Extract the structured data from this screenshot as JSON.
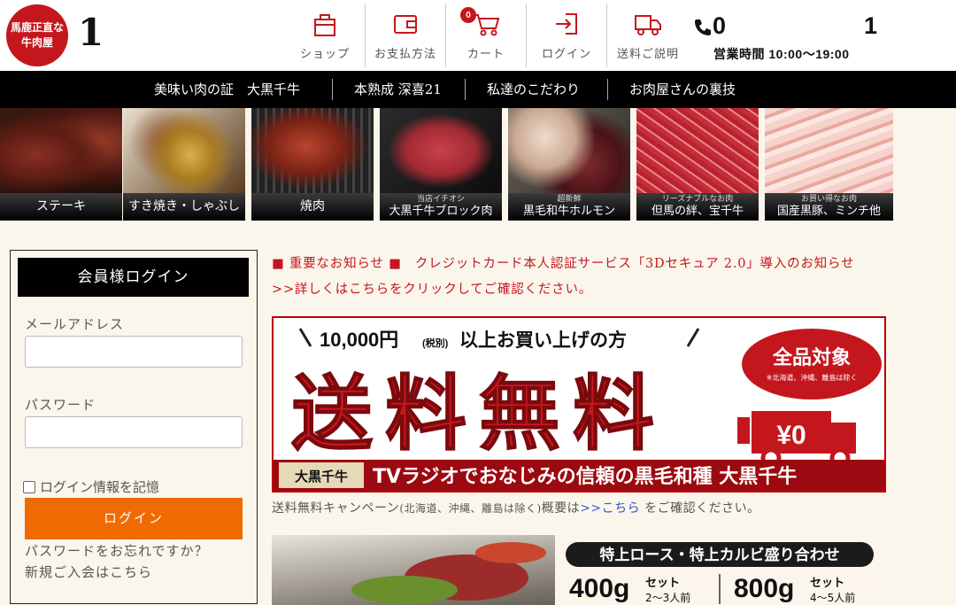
{
  "header": {
    "logo_lines": [
      "馬鹿正直な",
      "牛肉屋"
    ],
    "brand_fragment": "1",
    "nav": [
      {
        "label": "ショップ",
        "icon": "shop-bag-icon"
      },
      {
        "label": "お支払方法",
        "icon": "wallet-icon"
      },
      {
        "label": "カート",
        "icon": "cart-icon"
      },
      {
        "label": "ログイン",
        "icon": "login-icon"
      },
      {
        "label": "送料ご説明",
        "icon": "truck-icon"
      }
    ],
    "cart_count": "0",
    "tel_start": "0",
    "tel_end": "1",
    "hours": "営業時間 10:00〜19:00"
  },
  "topnav": [
    "美味い肉の証　大黒千牛",
    "本熟成 深喜21",
    "私達のこだわり",
    "お肉屋さんの裏技"
  ],
  "categories": [
    {
      "sub": "",
      "label": "ステーキ"
    },
    {
      "sub": "",
      "label": "すき焼き・しゃぶしゃぶ"
    },
    {
      "sub": "",
      "label": "焼肉"
    },
    {
      "sub": "当店イチオシ",
      "label": "大黒千牛ブロック肉"
    },
    {
      "sub": "超新鮮",
      "label": "黒毛和牛ホルモン"
    },
    {
      "sub": "リーズナブルなお肉",
      "label": "但馬の絆、宝千牛"
    },
    {
      "sub": "お買い得なお肉",
      "label": "国産黒豚、ミンチ他"
    }
  ],
  "login": {
    "title": "会員様ログイン",
    "email_label": "メールアドレス",
    "email_value": "",
    "password_label": "パスワード",
    "password_value": "",
    "remember": "ログイン情報を記憶",
    "button": "ログイン",
    "forgot": "パスワードをお忘れですか？",
    "register": "新規ご入会はこちら"
  },
  "notice": {
    "line1": "■ 重要なお知らせ ■　クレジットカード本人認証サービス「3Dセキュア 2.0」導入のお知らせ",
    "line2": ">>詳しくはこちらをクリックしてご確認ください。"
  },
  "banner_free": {
    "top": "10,000円",
    "top_tax": "(税別)",
    "top_rest": "以上お買い上げの方",
    "headline": "送料無料",
    "badge": "全品対象",
    "badge_note": "※北海道、沖縄、離島は除く",
    "truck_price": "¥0",
    "brand_box": "大黒千牛",
    "tagline": "TVラジオでおなじみの信頼の黒毛和種 大黒千牛"
  },
  "campaign": {
    "before": "送料無料キャンペーン",
    "paren": "(北海道、沖縄、離島は除く)",
    "mid": "概要は",
    "link": ">>こちら",
    "after": " をご確認ください。"
  },
  "banner_bbq": {
    "title": "特上ロース・特上カルビ盛り合わせ",
    "w1": "400g",
    "set1": "セット",
    "serv1": "2〜3人前",
    "w2": "800g",
    "set2": "セット",
    "serv2": "4〜5人前"
  },
  "colors": {
    "brand_red": "#c4171d",
    "button_orange": "#ef6a00",
    "nav_black": "#000000"
  }
}
